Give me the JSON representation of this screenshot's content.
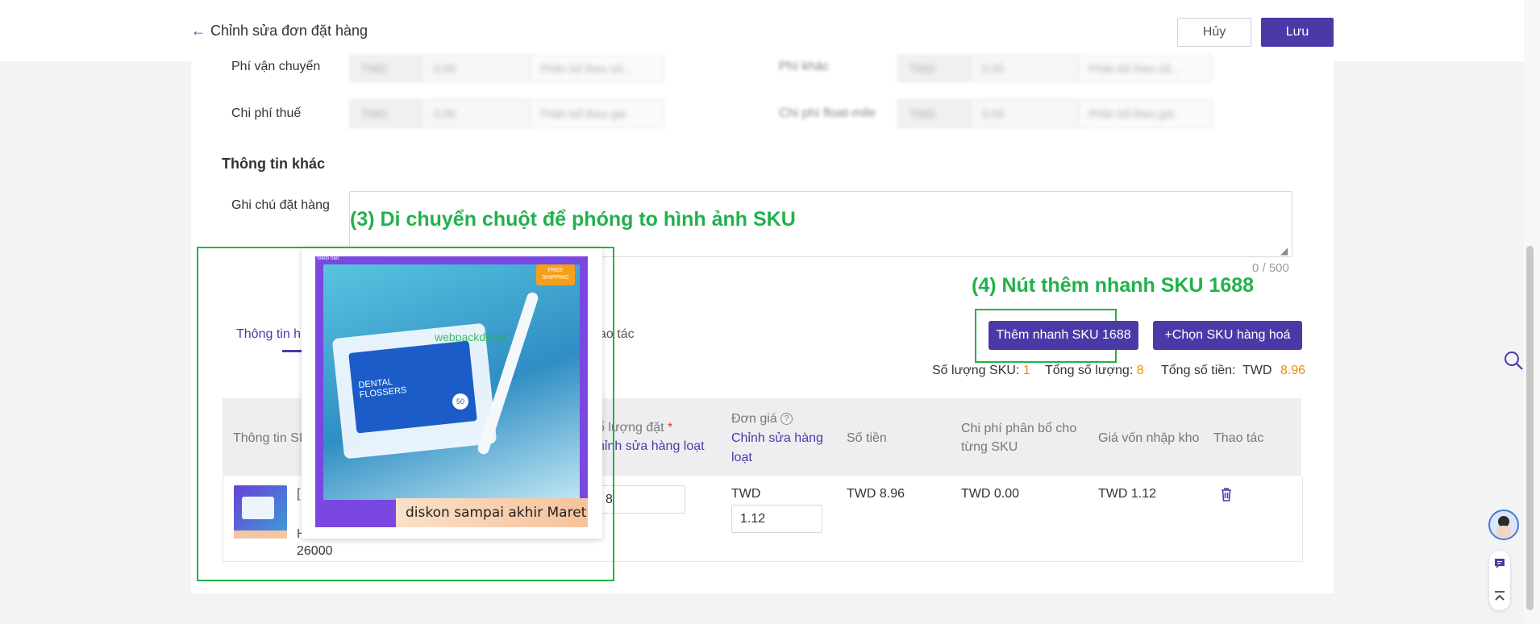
{
  "header": {
    "back_label": "Chỉnh sửa đơn đặt hàng",
    "cancel_label": "Hủy",
    "save_label": "Lưu"
  },
  "costs": {
    "shipping_label": "Phí vận chuyển",
    "tax_label": "Chi phí thuế",
    "shipping_currency": "TWD",
    "shipping_value": "0.00",
    "shipping_alloc": "Phân bổ theo số...",
    "tax_currency": "TWD",
    "tax_value": "0.00",
    "tax_alloc": "Phân bổ theo giá",
    "other_label": "Phí khác",
    "other_currency": "TWD",
    "other_value": "0.00",
    "other_alloc": "Phân bổ theo số...",
    "float_label": "Chi phí float-mile",
    "float_currency": "TWD",
    "float_value": "0.00",
    "float_alloc": "Phân bổ theo giá"
  },
  "other_info": {
    "title": "Thông tin khác",
    "note_label": "Ghi chú đặt hàng",
    "note_value": "",
    "counter": "0 / 500"
  },
  "annotations": {
    "step3": "(3)  Di chuyển chuột để phóng to hình ảnh SKU",
    "step4": "(4) Nút thêm nhanh SKU 1688"
  },
  "actions": {
    "quick_add_label": "Thêm nhanh SKU 1688",
    "choose_label": "+Chọn SKU hàng hoá"
  },
  "tabs": {
    "active": "Thông tin h",
    "other": "ao tác"
  },
  "stats": {
    "sku_count_label": "Số lượng SKU:",
    "sku_count": "1",
    "total_qty_label": "Tổng số lượng:",
    "total_qty": "8",
    "total_amount_label": "Tổng số tiền:",
    "currency": "TWD",
    "total_amount": "8.96"
  },
  "table": {
    "col_info": "Thông tin SI",
    "col_qty": "ố lượng đặt",
    "col_qty_required": "*",
    "col_qty_link": "hỉnh sửa hàng loạt",
    "col_price": "Đơn giá",
    "col_price_link_1": "Chỉnh sửa hàng",
    "col_price_link_2": "loạt",
    "col_amount": "Số tiền",
    "col_alloc_1": "Chi phí phân bổ cho",
    "col_alloc_2": "từng SKU",
    "col_cost_price": "Giá vốn nhập kho",
    "col_ops": "Thao tác",
    "row": {
      "info_partial_1": "[",
      "info_partial_2": "ﾠ",
      "info_partial_3": "H",
      "info_code": "26000",
      "qty": "8",
      "price_currency": "TWD",
      "price": "1.12",
      "amount": "TWD 8.96",
      "alloc": "TWD 0.00",
      "cost_price": "TWD 1.12"
    }
  },
  "popup": {
    "watermark": "webpackdirect",
    "badge": "FREE SHIPPING",
    "brand": "DENTAL FLOSSERS",
    "count": "50",
    "banner": "diskon sampai akhir Maret",
    "corner": "Sifelo Siet"
  },
  "colors": {
    "accent": "#4a3aa8",
    "annotation": "#22b14c",
    "highlight": "#f08c00"
  }
}
